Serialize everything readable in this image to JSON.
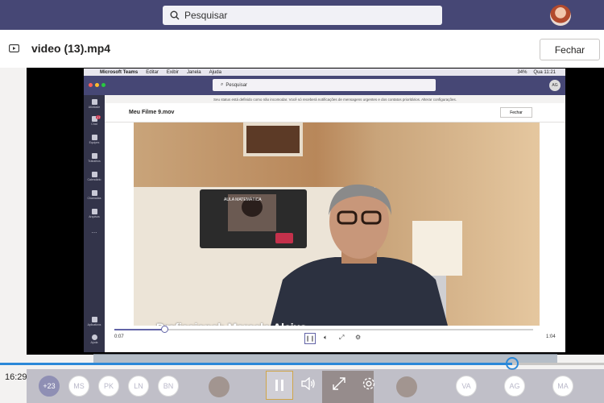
{
  "header": {
    "search_placeholder": "Pesquisar"
  },
  "file": {
    "title": "video (13).mp4",
    "close_label": "Fechar"
  },
  "inner_app": {
    "menubar": [
      "Microsoft Teams",
      "Editar",
      "Exibir",
      "Janela",
      "Ajuda"
    ],
    "menubar_status": {
      "battery": "34%",
      "time": "Qua 11:21"
    },
    "search_placeholder": "Pesquisar",
    "avatar_initials": "AG",
    "notice": "Seu status está definido como não incomodar. Você só receberá notificações de mensagens urgentes e dos contatos prioritários. Alterar configurações.",
    "rail": [
      {
        "label": "Atividade"
      },
      {
        "label": "Chat",
        "badge": "17"
      },
      {
        "label": "Equipes"
      },
      {
        "label": "Trabalhos"
      },
      {
        "label": "Calendário"
      },
      {
        "label": "Chamadas"
      },
      {
        "label": "Arquivos"
      },
      {
        "label": "..."
      }
    ],
    "rail_bottom": [
      {
        "label": "Aplicativos"
      },
      {
        "label": "Ajuda"
      }
    ],
    "file_title": "Meu Filme 9.mov",
    "close_label": "Fechar",
    "minicall_label": "AULA MATEMÁTICA",
    "caption": "Profissional: Marcelo Aleixo",
    "elapsed": "0:07",
    "duration": "1:04",
    "progress": 0.12
  },
  "player": {
    "current_time": "16:29",
    "progress": 0.848
  },
  "participants": [
    {
      "initials": "+23",
      "count": true
    },
    {
      "initials": "MS"
    },
    {
      "initials": "PK"
    },
    {
      "initials": "LN"
    },
    {
      "initials": "BN"
    }
  ],
  "participants_right": [
    {
      "initials": "VA"
    },
    {
      "initials": "AG"
    },
    {
      "initials": "MA"
    }
  ],
  "colors": {
    "teams_purple": "#464775",
    "progress_blue": "#2b88d8"
  },
  "icons": [
    "search-icon",
    "video-file-icon",
    "pause-icon",
    "volume-icon",
    "fullscreen-icon",
    "settings-icon"
  ]
}
